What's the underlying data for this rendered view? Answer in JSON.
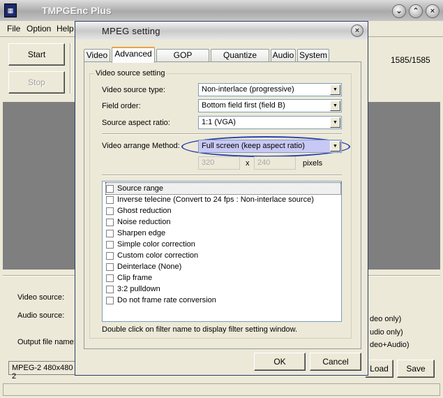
{
  "app": {
    "title": "TMPGEnc Plus",
    "icon": "film-icon",
    "window_buttons": [
      "minimize",
      "maximize",
      "close"
    ]
  },
  "menu": {
    "file": "File",
    "option": "Option",
    "help": "Help"
  },
  "main": {
    "start": "Start",
    "stop": "Stop",
    "progress": "1585/1585",
    "video_source_label": "Video source:",
    "audio_source_label": "Audio source:",
    "output_label": "Output file name:",
    "right_video": "deo only)",
    "right_audio": "udio only)",
    "right_both": "deo+Audio)",
    "format": "MPEG-2 480x480 2",
    "load": "Load",
    "save": "Save"
  },
  "dialog": {
    "title": "MPEG setting",
    "tabs": [
      "Video",
      "Advanced",
      "GOP structure",
      "Quantize matrix",
      "Audio",
      "System"
    ],
    "active_tab": "Advanced",
    "group_title": "Video source setting",
    "source_type_label": "Video source type:",
    "source_type_value": "Non-interlace (progressive)",
    "field_order_label": "Field order:",
    "field_order_value": "Bottom field first (field B)",
    "aspect_label": "Source aspect ratio:",
    "aspect_value": "1:1 (VGA)",
    "arrange_label": "Video arrange Method:",
    "arrange_value": "Full screen (keep aspect ratio)",
    "width": "320",
    "x": "x",
    "height": "240",
    "pixels": "pixels",
    "filters": [
      "Source range",
      "Inverse telecine (Convert to 24 fps : Non-interlace source)",
      "Ghost reduction",
      "Noise reduction",
      "Sharpen edge",
      "Simple color correction",
      "Custom color correction",
      "Deinterlace (None)",
      "Clip frame",
      "3:2 pulldown",
      "Do not frame rate conversion"
    ],
    "hint": "Double click on filter name to display filter setting window.",
    "ok": "OK",
    "cancel": "Cancel",
    "highlight_color": "#2b3fb0"
  }
}
